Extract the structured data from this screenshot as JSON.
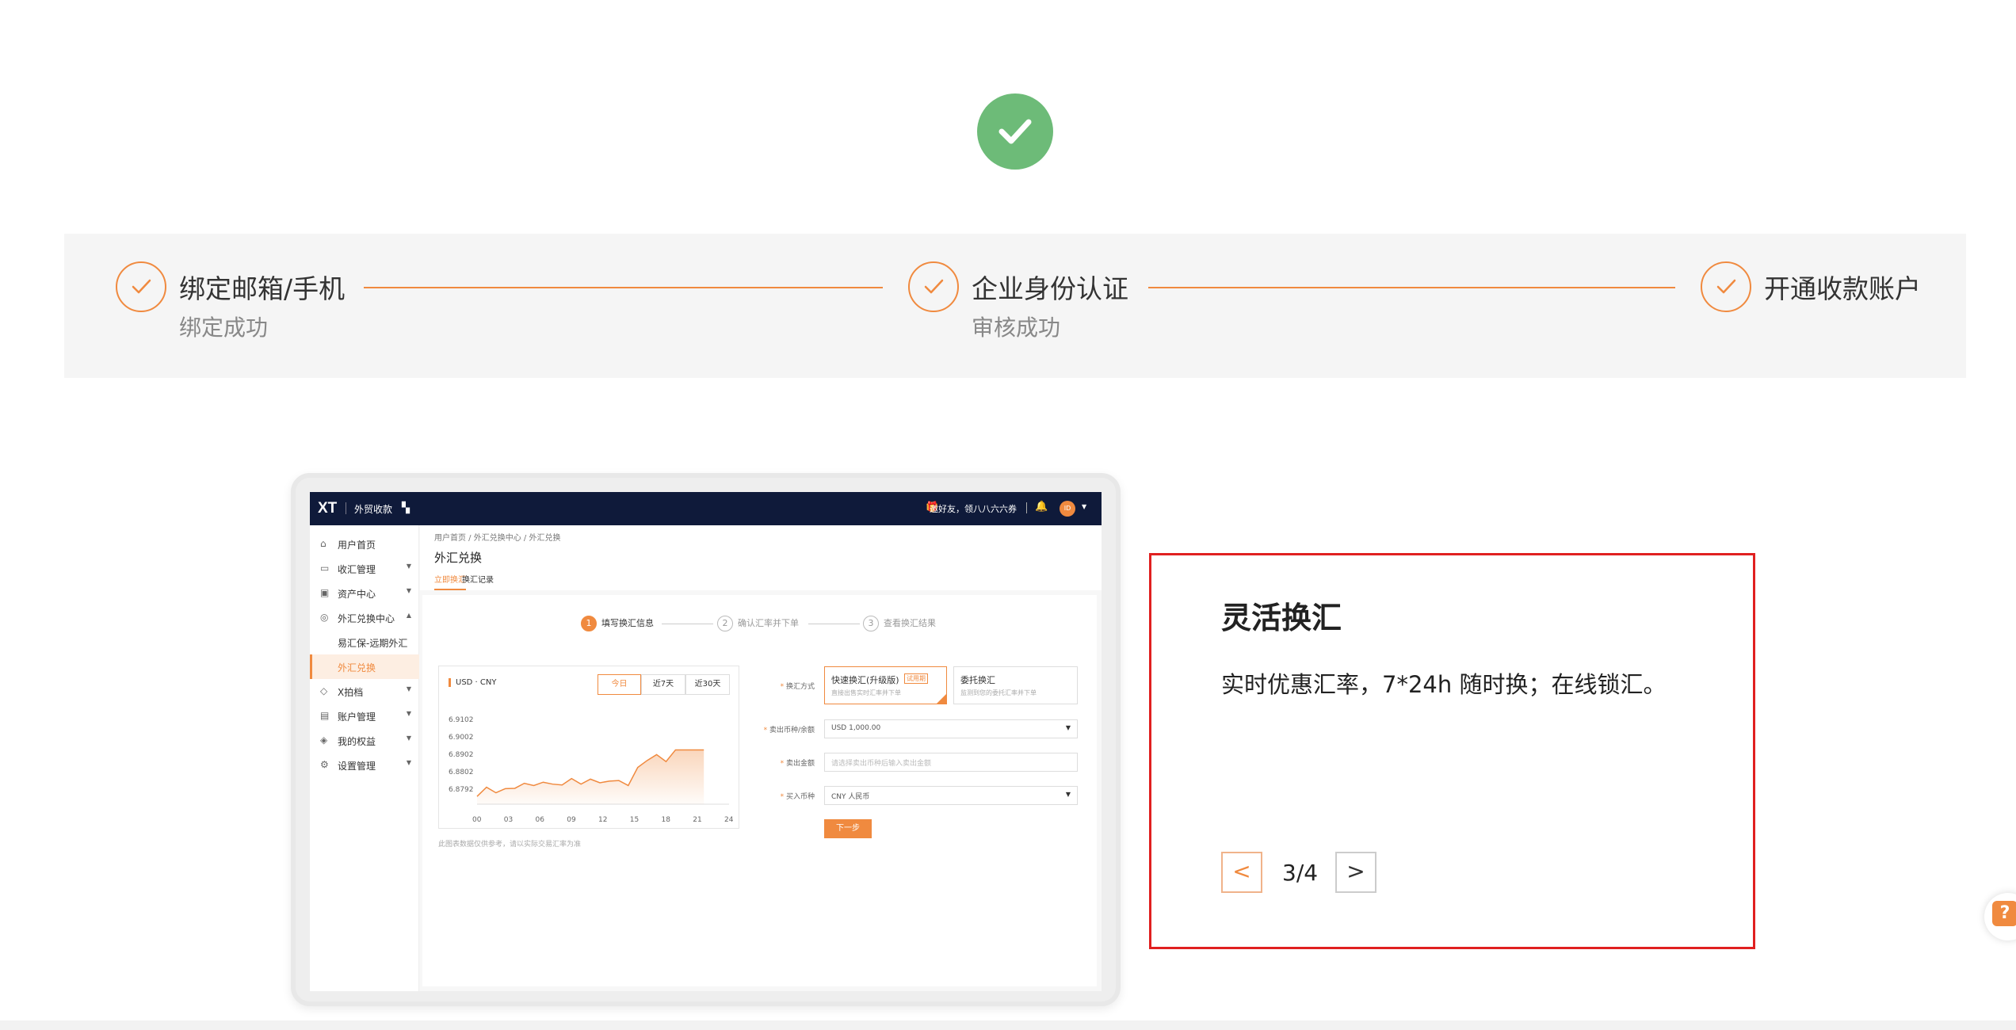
{
  "steps": [
    {
      "title": "绑定邮箱/手机",
      "sub": "绑定成功"
    },
    {
      "title": "企业身份认证",
      "sub": "审核成功"
    },
    {
      "title": "开通收款账户",
      "sub": ""
    }
  ],
  "preview": {
    "logo": "XT",
    "brand": "外贸收款",
    "invite": "邀好友，领八八六六券",
    "avatar": "ID",
    "sidebar": [
      {
        "label": "用户首页",
        "icon": "home-icon",
        "arrow": false
      },
      {
        "label": "收汇管理",
        "icon": "receive-icon",
        "arrow": true
      },
      {
        "label": "资产中心",
        "icon": "wallet-icon",
        "arrow": true
      },
      {
        "label": "外汇兑换中心",
        "icon": "exchange-icon",
        "arrow": true
      },
      {
        "label": "易汇保-远期外汇",
        "icon": "",
        "arrow": false
      },
      {
        "label": "外汇兑换",
        "icon": "",
        "arrow": false
      },
      {
        "label": "X拍档",
        "icon": "diamond-icon",
        "arrow": true
      },
      {
        "label": "账户管理",
        "icon": "account-icon",
        "arrow": true
      },
      {
        "label": "我的权益",
        "icon": "gift-icon",
        "arrow": true
      },
      {
        "label": "设置管理",
        "icon": "settings-icon",
        "arrow": true
      }
    ],
    "breadcrumb": "用户首页  /  外汇兑换中心  /  外汇兑换",
    "title": "外汇兑换",
    "tabs": [
      "立即换汇",
      "换汇记录"
    ],
    "flow": [
      "填写换汇信息",
      "确认汇率并下单",
      "查看换汇结果"
    ],
    "pair_base": "USD",
    "pair_quote": "CNY",
    "ranges": [
      "今日",
      "近7天",
      "近30天"
    ],
    "chart_note": "此图表数据仅供参考，请以实际交易汇率为准",
    "form": {
      "method_label": "换汇方式",
      "fast_title": "快速换汇(升级版)",
      "fast_tag": "试用期",
      "fast_desc": "直接出售实时汇率并下单",
      "entrust_title": "委托换汇",
      "entrust_desc": "监测到您的委托汇率并下单",
      "sell_currency_label": "卖出币种/余额",
      "sell_currency_value": "USD 1,000.00",
      "sell_amount_label": "卖出金额",
      "sell_amount_placeholder": "请选择卖出币种后输入卖出金额",
      "buy_currency_label": "买入币种",
      "buy_currency_value": "CNY 人民币",
      "next_label": "下一步"
    }
  },
  "chart_data": {
    "type": "area",
    "title": "",
    "xlabel": "",
    "ylabel": "",
    "x_ticks": [
      "00",
      "03",
      "06",
      "09",
      "12",
      "15",
      "18",
      "21",
      "24"
    ],
    "y_ticks": [
      "6.9102",
      "6.9002",
      "6.8902",
      "6.8802",
      "6.8792"
    ],
    "x": [
      0,
      0.9,
      1.8,
      2.7,
      3.6,
      4.5,
      5.4,
      6.3,
      7.2,
      8.1,
      9.0,
      9.9,
      10.8,
      11.7,
      12.6,
      13.5,
      14.4,
      15.3,
      16.2,
      17.1,
      18.0,
      18.9,
      19.8,
      20.7,
      21.6
    ],
    "values": [
      6.8808,
      6.8841,
      6.8821,
      6.8836,
      6.8837,
      6.8855,
      6.8847,
      6.8859,
      6.8852,
      6.8849,
      6.8872,
      6.8852,
      6.887,
      6.8857,
      6.8863,
      6.8865,
      6.8847,
      6.8912,
      6.8937,
      6.8958,
      6.8933,
      6.8975,
      6.8975,
      6.8975,
      6.8975
    ],
    "ylim": [
      6.878,
      6.911
    ],
    "color": "#f08a3f"
  },
  "panel": {
    "title": "灵活换汇",
    "desc": "实时优惠汇率，7*24h 随时换；在线锁汇。",
    "prev": "<",
    "next": ">",
    "counter": "3/4"
  },
  "help": "?",
  "colors": {
    "accent": "#f08a3f",
    "success": "#6dbb78",
    "highlight": "#e02020"
  }
}
